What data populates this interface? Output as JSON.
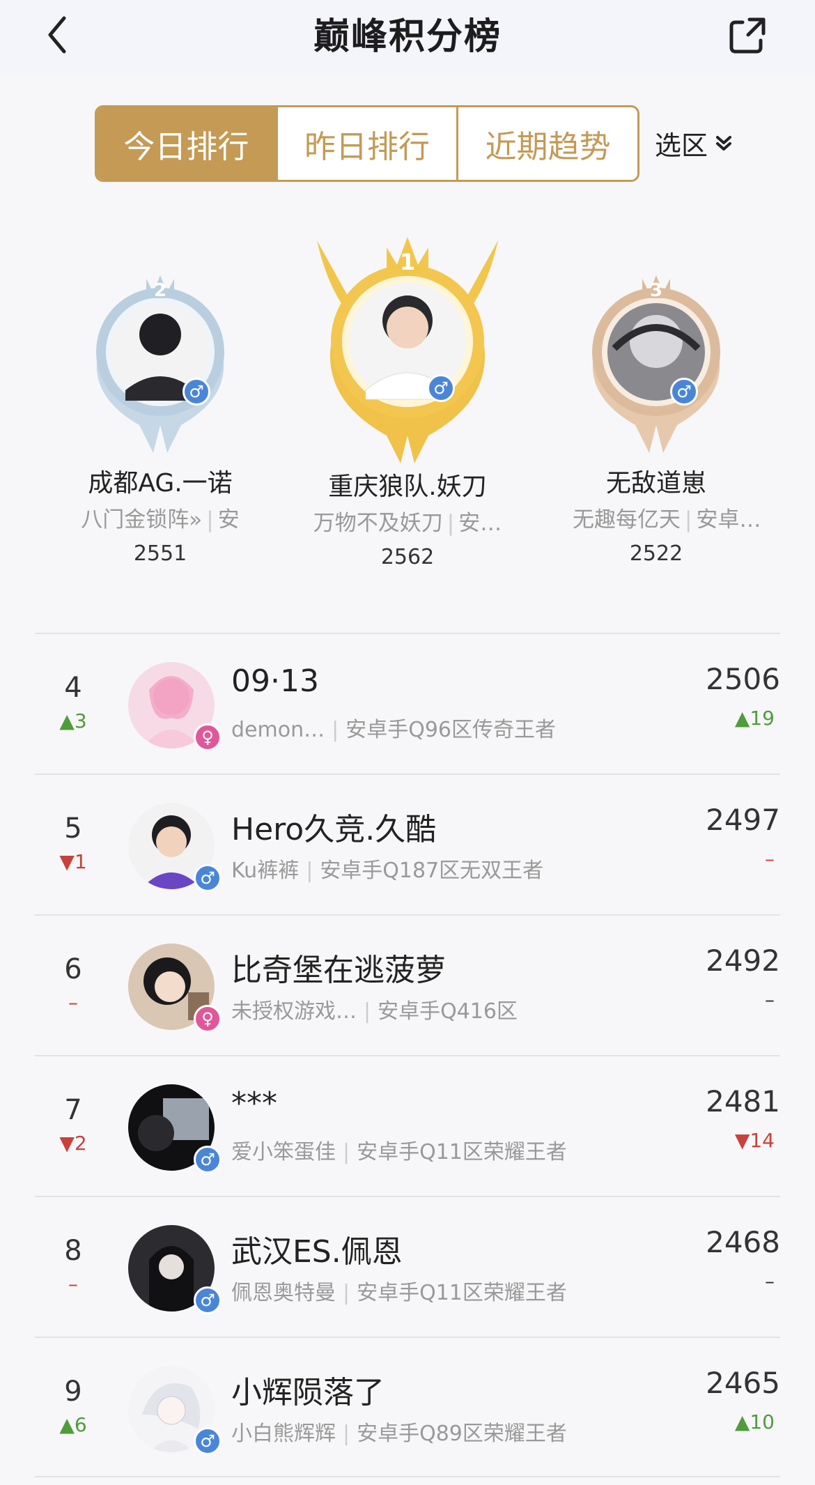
{
  "header": {
    "title": "巅峰积分榜"
  },
  "tabs": [
    {
      "label": "今日排行",
      "active": true
    },
    {
      "label": "昨日排行",
      "active": false
    },
    {
      "label": "近期趋势",
      "active": false
    }
  ],
  "region": {
    "label": "选区"
  },
  "top3": [
    {
      "place": "2",
      "name": "成都AG.一诺",
      "game_name": "八门金锁阵»",
      "platform": "安",
      "score": "2551",
      "gender": "♂"
    },
    {
      "place": "1",
      "name": "重庆狼队.妖刀",
      "game_name": "万物不及妖刀",
      "platform": "安…",
      "score": "2562",
      "gender": "♂"
    },
    {
      "place": "3",
      "name": "无敌道崽",
      "game_name": "无趣每亿天",
      "platform": "安卓…",
      "score": "2522",
      "gender": "♂"
    }
  ],
  "rows": [
    {
      "rank": "4",
      "delta": "▲3",
      "delta_dir": "up",
      "name": "09·13",
      "game_name": "demon…",
      "server": "安卓手Q96区传奇王者",
      "score": "2506",
      "score_delta": "▲19",
      "score_dir": "up",
      "gender": "♀",
      "gender_type": "f"
    },
    {
      "rank": "5",
      "delta": "▼1",
      "delta_dir": "down",
      "name": "Hero久竞.久酷",
      "game_name": "Ku裤裤",
      "server": "安卓手Q187区无双王者",
      "score": "2497",
      "score_delta": "–",
      "score_dir": "flat",
      "gender": "♂",
      "gender_type": "m"
    },
    {
      "rank": "6",
      "delta": "–",
      "delta_dir": "flat",
      "name": "比奇堡在逃菠萝",
      "game_name": "未授权游戏…",
      "server": "安卓手Q416区",
      "score": "2492",
      "score_delta": "–",
      "score_dir": "flat",
      "gender": "♀",
      "gender_type": "f"
    },
    {
      "rank": "7",
      "delta": "▼2",
      "delta_dir": "down",
      "name": "***",
      "game_name": "爱小笨蛋佳",
      "server": "安卓手Q11区荣耀王者",
      "score": "2481",
      "score_delta": "▼14",
      "score_dir": "down",
      "gender": "♂",
      "gender_type": "m"
    },
    {
      "rank": "8",
      "delta": "–",
      "delta_dir": "flat",
      "name": "武汉ES.佩恩",
      "game_name": "佩恩奥特曼",
      "server": "安卓手Q11区荣耀王者",
      "score": "2468",
      "score_delta": "–",
      "score_dir": "flat",
      "gender": "♂",
      "gender_type": "m"
    },
    {
      "rank": "9",
      "delta": "▲6",
      "delta_dir": "up",
      "name": "小辉陨落了",
      "game_name": "小白熊辉辉",
      "server": "安卓手Q89区荣耀王者",
      "score": "2465",
      "score_delta": "▲10",
      "score_dir": "up",
      "gender": "♂",
      "gender_type": "m"
    }
  ],
  "colors": {
    "gold": "#c49a55",
    "up": "#4f9c3a",
    "down": "#c9413a",
    "male": "#4a86d8",
    "female": "#e0579a"
  }
}
